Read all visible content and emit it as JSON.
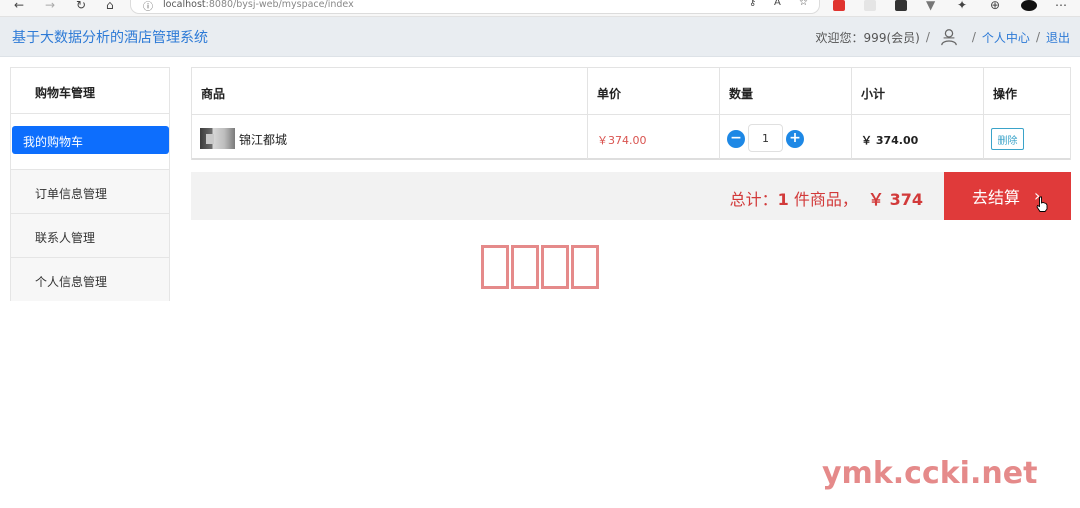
{
  "browser": {
    "url_host": "localhost",
    "url_path": ":8080/bysj-web/myspace/index"
  },
  "header": {
    "app_title": "基于大数据分析的酒店管理系统",
    "welcome": "欢迎您：999(会员)",
    "sep": "/",
    "personal_center": "个人中心",
    "logout": "退出"
  },
  "sidebar": {
    "heading": "购物车管理",
    "active_item": "我的购物车",
    "items": [
      "订单信息管理",
      "联系人管理",
      "个人信息管理"
    ]
  },
  "cart": {
    "columns": [
      "商品",
      "单价",
      "数量",
      "小计",
      "操作"
    ],
    "rows": [
      {
        "product": "锦江都城",
        "price": "￥374.00",
        "quantity": "1",
        "subtotal": "￥ 374.00",
        "action": "删除"
      }
    ]
  },
  "checkout": {
    "total_prefix": "总计：",
    "count": "1",
    "count_suffix": " 件商品，",
    "amount": "￥ 374",
    "button_label": "去结算",
    "button_chevron": "›"
  },
  "watermark": "ymk.ccki.net",
  "colors": {
    "brand_blue": "#2d7ad6",
    "active_blue": "#0d6efd",
    "danger_red": "#e03a3a",
    "info_teal": "#3aa3c9"
  }
}
